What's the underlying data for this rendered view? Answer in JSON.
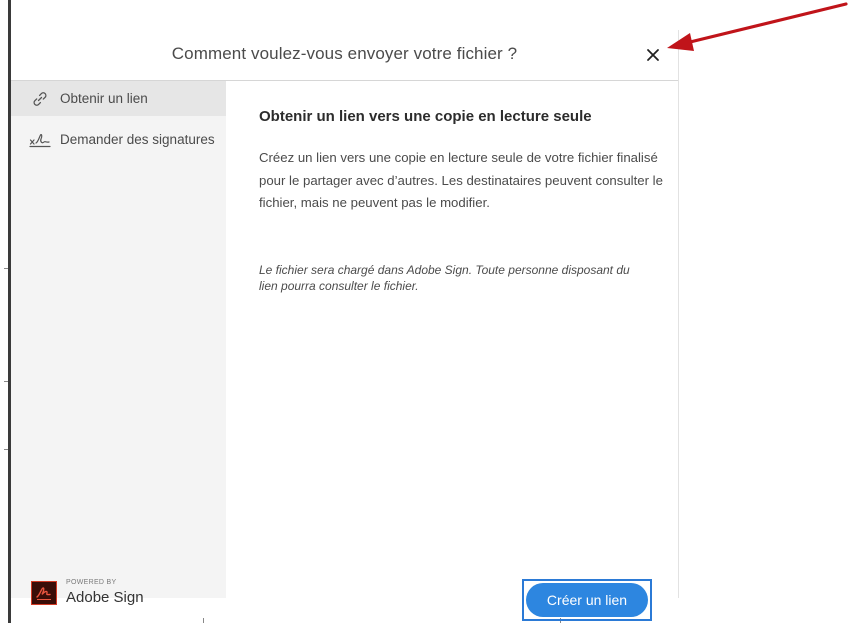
{
  "dialog": {
    "title": "Comment voulez-vous envoyer votre fichier ?",
    "close_icon": "close-icon"
  },
  "sidebar": {
    "items": [
      {
        "label": "Obtenir un lien",
        "icon": "link-icon",
        "active": true
      },
      {
        "label": "Demander des signatures",
        "icon": "signature-icon",
        "active": false
      }
    ],
    "brand": {
      "powered_by": "POWERED BY",
      "name": "Adobe Sign",
      "logo_icon": "adobe-sign-logo"
    }
  },
  "content": {
    "title": "Obtenir un lien vers une copie en lecture seule",
    "description": "Créez un lien vers une copie en lecture seule de votre fichier finalisé pour le partager avec d’autres. Les destinataires peuvent consulter le fichier, mais ne peuvent pas le modifier.",
    "note": "Le fichier sera chargé dans Adobe Sign. Toute personne disposant du lien pourra consulter le fichier.",
    "button_label": "Créer un lien"
  },
  "colors": {
    "accent": "#2d86e0",
    "annotation_arrow": "#c0141a",
    "sidebar_bg": "#f4f4f4",
    "active_item_bg": "#e6e6e6"
  }
}
